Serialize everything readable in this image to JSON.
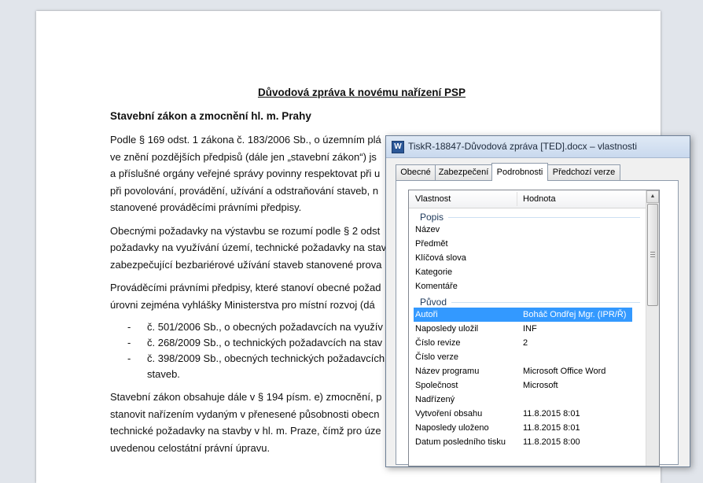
{
  "document": {
    "title": "Důvodová zpráva k novému nařízení PSP",
    "heading": "Stavební zákon a zmocnění hl. m. Prahy",
    "paragraph1": [
      "Podle § 169 odst. 1 zákona č. 183/2006  Sb., o územním plá",
      "ve znění pozdějších předpisů (dále jen „stavební zákon“) js",
      "a příslušné orgány veřejné správy povinny respektovat při u",
      "při povolování, provádění, užívání a odstraňování staveb, n",
      "stanovené prováděcími právními předpisy."
    ],
    "paragraph2": [
      "Obecnými požadavky na výstavbu se rozumí podle § 2 odst",
      "požadavky na využívání území, technické požadavky na stav",
      "zabezpečující bezbariérové užívání staveb stanovené prova"
    ],
    "paragraph3": [
      "Prováděcími právními předpisy, které stanoví obecné požad",
      "úrovni zejména vyhlášky Ministerstva pro místní rozvoj (dá"
    ],
    "list": [
      {
        "dash": "-",
        "text": "č. 501/2006  Sb., o obecných požadavcích na využív",
        "cont": ""
      },
      {
        "dash": "-",
        "text": "č. 268/2009  Sb., o technických požadavcích na stav",
        "cont": ""
      },
      {
        "dash": "-",
        "text": "č. 398/2009  Sb., obecných technických požadavcích",
        "cont": "staveb."
      }
    ],
    "paragraph4": [
      "Stavební zákon obsahuje dále v § 194  písm. e) zmocnění, p",
      "stanovit nařízením vydaným v přenesené působnosti obecn",
      "technické požadavky na stavby v hl. m. Praze, čímž pro úze",
      "uvedenou celostátní právní úpravu."
    ]
  },
  "dialog": {
    "icon": "word-doc-icon",
    "title": "TiskR-18847-Důvodová zpráva [TED].docx – vlastnosti",
    "tabs": [
      {
        "label": "Obecné",
        "active": false
      },
      {
        "label": "Zabezpečení",
        "active": false
      },
      {
        "label": "Podrobnosti",
        "active": true
      },
      {
        "label": "Předchozí verze",
        "active": false
      }
    ],
    "columns": {
      "property": "Vlastnost",
      "value": "Hodnota"
    },
    "groups": {
      "popis": "Popis",
      "puvod": "Původ"
    },
    "popis_rows": [
      {
        "name": "Název",
        "value": ""
      },
      {
        "name": "Předmět",
        "value": ""
      },
      {
        "name": "Klíčová slova",
        "value": ""
      },
      {
        "name": "Kategorie",
        "value": ""
      },
      {
        "name": "Komentáře",
        "value": ""
      }
    ],
    "puvod_rows": [
      {
        "name": "Autoři",
        "value": "Boháč Ondřej Mgr. (IPR/Ř)",
        "selected": true
      },
      {
        "name": "Naposledy uložil",
        "value": "INF"
      },
      {
        "name": "Číslo revize",
        "value": "2"
      },
      {
        "name": "Číslo verze",
        "value": ""
      },
      {
        "name": "Název programu",
        "value": "Microsoft Office Word"
      },
      {
        "name": "Společnost",
        "value": "Microsoft"
      },
      {
        "name": "Nadřízený",
        "value": ""
      },
      {
        "name": "Vytvoření obsahu",
        "value": "11.8.2015 8:01"
      },
      {
        "name": "Naposledy uloženo",
        "value": "11.8.2015 8:01"
      },
      {
        "name": "Datum posledního tisku",
        "value": "11.8.2015 8:00"
      }
    ],
    "colors": {
      "selection": "#3399ff",
      "group_text": "#1e395b"
    }
  }
}
